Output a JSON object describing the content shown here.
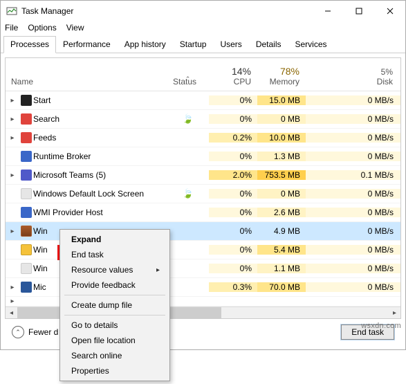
{
  "titlebar": {
    "title": "Task Manager"
  },
  "menubar": {
    "file": "File",
    "options": "Options",
    "view": "View"
  },
  "tabs": {
    "processes": "Processes",
    "performance": "Performance",
    "app_history": "App history",
    "startup": "Startup",
    "users": "Users",
    "details": "Details",
    "services": "Services"
  },
  "columns": {
    "name": "Name",
    "status": "Status",
    "cpu_pct": "14%",
    "cpu_lbl": "CPU",
    "mem_pct": "78%",
    "mem_lbl": "Memory",
    "disk_pct": "5%",
    "disk_lbl": "Disk"
  },
  "rows": [
    {
      "name": "Start",
      "cpu": "0%",
      "mem": "15.0 MB",
      "disk": "0 MB/s",
      "icon": "start",
      "exp": true,
      "leaf": false
    },
    {
      "name": "Search",
      "cpu": "0%",
      "mem": "0 MB",
      "disk": "0 MB/s",
      "icon": "search",
      "exp": true,
      "leaf": true
    },
    {
      "name": "Feeds",
      "cpu": "0.2%",
      "mem": "10.0 MB",
      "disk": "0 MB/s",
      "icon": "feeds",
      "exp": true,
      "leaf": false
    },
    {
      "name": "Runtime Broker",
      "cpu": "0%",
      "mem": "1.3 MB",
      "disk": "0 MB/s",
      "icon": "runtime",
      "exp": false,
      "leaf": false
    },
    {
      "name": "Microsoft Teams (5)",
      "cpu": "2.0%",
      "mem": "753.5 MB",
      "disk": "0.1 MB/s",
      "icon": "teams",
      "exp": true,
      "leaf": false
    },
    {
      "name": "Windows Default Lock Screen",
      "cpu": "0%",
      "mem": "0 MB",
      "disk": "0 MB/s",
      "icon": "blank",
      "exp": false,
      "leaf": true
    },
    {
      "name": "WMI Provider Host",
      "cpu": "0%",
      "mem": "2.6 MB",
      "disk": "0 MB/s",
      "icon": "wmi",
      "exp": false,
      "leaf": false
    },
    {
      "name": "Win",
      "cpu": "0%",
      "mem": "4.9 MB",
      "disk": "0 MB/s",
      "icon": "winrar",
      "exp": true,
      "leaf": false,
      "selected": true
    },
    {
      "name": "Win",
      "cpu": "0%",
      "mem": "5.4 MB",
      "disk": "0 MB/s",
      "icon": "exp",
      "exp": false,
      "leaf": false
    },
    {
      "name": "Win",
      "cpu": "0%",
      "mem": "1.1 MB",
      "disk": "0 MB/s",
      "icon": "blank",
      "exp": false,
      "leaf": false
    },
    {
      "name": "Mic",
      "cpu": "0.3%",
      "mem": "70.0 MB",
      "disk": "0 MB/s",
      "icon": "word",
      "exp": true,
      "leaf": false
    }
  ],
  "context_menu": {
    "expand": "Expand",
    "end_task": "End task",
    "resource_values": "Resource values",
    "provide_feedback": "Provide feedback",
    "create_dump": "Create dump file",
    "go_to_details": "Go to details",
    "open_file_location": "Open file location",
    "search_online": "Search online",
    "properties": "Properties"
  },
  "footer": {
    "fewer": "Fewer d",
    "end_task_btn": "End task"
  },
  "watermark": "wsxdn.com"
}
